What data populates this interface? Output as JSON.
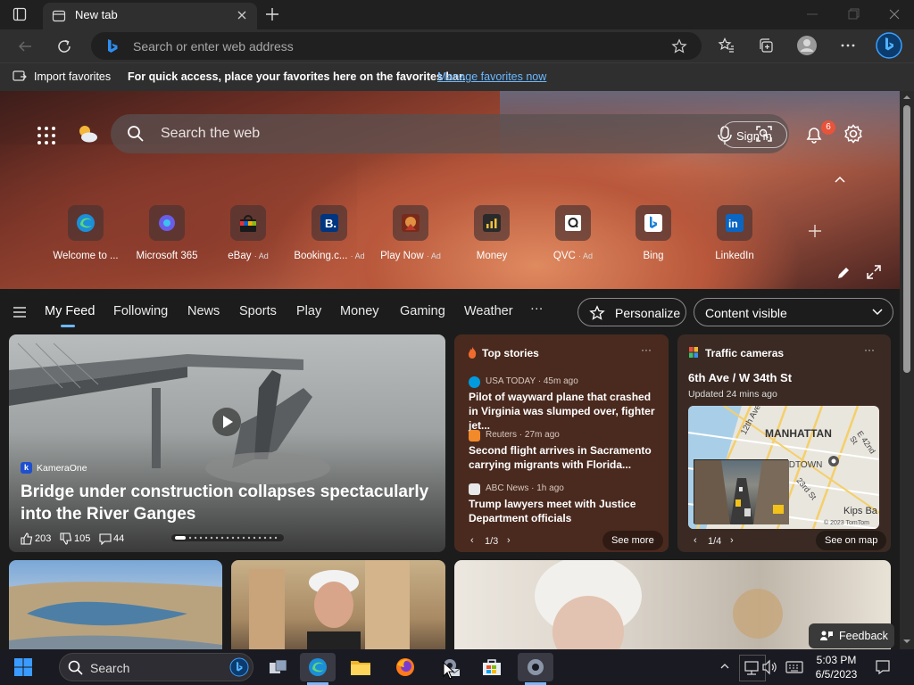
{
  "browser": {
    "tab_title": "New tab",
    "address_placeholder": "Search or enter web address"
  },
  "favorites_bar": {
    "import_label": "Import favorites",
    "message": "For quick access, place your favorites here on the favorites bar.",
    "manage_link": "Manage favorites now"
  },
  "newtab": {
    "search_placeholder": "Search the web",
    "signin_label": "Sign in",
    "notification_count": "6",
    "quick_links": [
      {
        "label": "Welcome to ...",
        "ad": ""
      },
      {
        "label": "Microsoft 365",
        "ad": ""
      },
      {
        "label": "eBay",
        "ad": "· Ad"
      },
      {
        "label": "Booking.c...",
        "ad": "· Ad"
      },
      {
        "label": "Play Now",
        "ad": "· Ad"
      },
      {
        "label": "Money",
        "ad": ""
      },
      {
        "label": "QVC",
        "ad": "· Ad"
      },
      {
        "label": "Bing",
        "ad": ""
      },
      {
        "label": "LinkedIn",
        "ad": ""
      }
    ]
  },
  "feed_nav": {
    "items": [
      "My Feed",
      "Following",
      "News",
      "Sports",
      "Play",
      "Money",
      "Gaming",
      "Weather"
    ],
    "more": "···",
    "personalize": "Personalize",
    "content_visible": "Content visible"
  },
  "main_card": {
    "source": "KameraOne",
    "headline": "Bridge under construction collapses spectacularly into the River Ganges",
    "likes": "203",
    "dislikes": "105",
    "comments": "44"
  },
  "top_stories": {
    "title": "Top stories",
    "stories": [
      {
        "source": "USA TODAY · 45m ago",
        "headline": "Pilot of wayward plane that crashed in Virginia was slumped over, fighter jet..."
      },
      {
        "source": "Reuters · 27m ago",
        "headline": "Second flight arrives in Sacramento carrying migrants with Florida..."
      },
      {
        "source": "ABC News · 1h ago",
        "headline": "Trump lawyers meet with Justice Department officials"
      }
    ],
    "pager": "1/3",
    "see_more": "See more"
  },
  "traffic": {
    "title": "Traffic cameras",
    "location": "6th Ave / W 34th St",
    "updated": "Updated 24 mins ago",
    "map_labels": [
      "MANHATTAN",
      "12th Ave",
      "E 42nd St",
      "IDTOWN",
      "23rd St",
      "Kips Ba",
      "© 2023 TomTom"
    ],
    "pager": "1/4",
    "see_on_map": "See on map"
  },
  "feedback_label": "Feedback",
  "taskbar": {
    "search_label": "Search",
    "time": "5:03 PM",
    "date": "6/5/2023"
  },
  "colors": {
    "accent_link": "#6cb8ff",
    "notification_badge": "#e8543a",
    "nav_underline": "#6cb8ff"
  }
}
